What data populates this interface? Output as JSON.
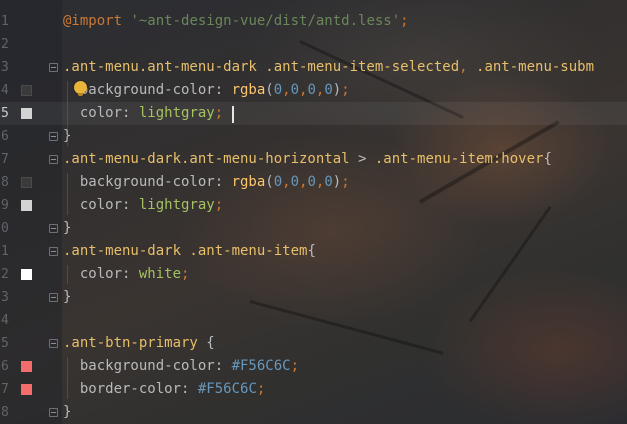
{
  "colors": {
    "background": "#2b2d33",
    "line_number": "#5f646b",
    "keyword": "#cc7832",
    "string": "#6a8759",
    "selector": "#e8bf6a",
    "property": "#bababa",
    "function": "#ffc66d",
    "number": "#6897bb",
    "value": "#a5c261",
    "swatch_transparent": "#3a3a3a",
    "swatch_lightgray": "#d3d3d3",
    "swatch_white": "#ffffff",
    "swatch_red": "#f56c6c"
  },
  "editor": {
    "current_line": 5,
    "lines": [
      {
        "n": "1",
        "tokens": [
          [
            "kw",
            "@import "
          ],
          [
            "str",
            "'~ant-design-vue/dist/antd.less'"
          ],
          [
            "punc",
            ";"
          ]
        ]
      },
      {
        "n": "2",
        "tokens": []
      },
      {
        "n": "3",
        "fold": true,
        "tokens": [
          [
            "sel",
            ".ant-menu.ant-menu-dark .ant-menu-item-selected"
          ],
          [
            "punc",
            ", "
          ],
          [
            "sel",
            ".ant-menu-subm"
          ]
        ]
      },
      {
        "n": "4",
        "swatch": "transparent",
        "tokens": [
          [
            "prop",
            "  background-color"
          ],
          [
            "plain",
            ": "
          ],
          [
            "fn",
            "rgba"
          ],
          [
            "plain",
            "("
          ],
          [
            "num",
            "0"
          ],
          [
            "punc",
            ","
          ],
          [
            "num",
            "0"
          ],
          [
            "punc",
            ","
          ],
          [
            "num",
            "0"
          ],
          [
            "punc",
            ","
          ],
          [
            "num",
            "0"
          ],
          [
            "plain",
            ")"
          ],
          [
            "punc",
            ";"
          ]
        ]
      },
      {
        "n": "5",
        "swatch": "lightgray",
        "tokens": [
          [
            "prop",
            "  color"
          ],
          [
            "plain",
            ": "
          ],
          [
            "val",
            "lightgray"
          ],
          [
            "punc",
            ";"
          ]
        ]
      },
      {
        "n": "6",
        "fold": true,
        "tokens": [
          [
            "plain",
            "}"
          ]
        ]
      },
      {
        "n": "7",
        "fold": true,
        "tokens": [
          [
            "sel",
            ".ant-menu-dark.ant-menu-horizontal "
          ],
          [
            "plain",
            "> "
          ],
          [
            "sel",
            ".ant-menu-item:hover"
          ],
          [
            "plain",
            "{"
          ]
        ]
      },
      {
        "n": "8",
        "swatch": "transparent",
        "tokens": [
          [
            "prop",
            "  background-color"
          ],
          [
            "plain",
            ": "
          ],
          [
            "fn",
            "rgba"
          ],
          [
            "plain",
            "("
          ],
          [
            "num",
            "0"
          ],
          [
            "punc",
            ","
          ],
          [
            "num",
            "0"
          ],
          [
            "punc",
            ","
          ],
          [
            "num",
            "0"
          ],
          [
            "punc",
            ","
          ],
          [
            "num",
            "0"
          ],
          [
            "plain",
            ")"
          ],
          [
            "punc",
            ";"
          ]
        ]
      },
      {
        "n": "9",
        "swatch": "lightgray",
        "tokens": [
          [
            "prop",
            "  color"
          ],
          [
            "plain",
            ": "
          ],
          [
            "val",
            "lightgray"
          ],
          [
            "punc",
            ";"
          ]
        ]
      },
      {
        "n": "0",
        "fold": true,
        "tokens": [
          [
            "plain",
            "}"
          ]
        ]
      },
      {
        "n": "1",
        "fold": true,
        "tokens": [
          [
            "sel",
            ".ant-menu-dark .ant-menu-item"
          ],
          [
            "plain",
            "{"
          ]
        ]
      },
      {
        "n": "2",
        "swatch": "white",
        "tokens": [
          [
            "prop",
            "  color"
          ],
          [
            "plain",
            ": "
          ],
          [
            "val",
            "white"
          ],
          [
            "punc",
            ";"
          ]
        ]
      },
      {
        "n": "3",
        "fold": true,
        "tokens": [
          [
            "plain",
            "}"
          ]
        ]
      },
      {
        "n": "4",
        "tokens": []
      },
      {
        "n": "5",
        "fold": true,
        "tokens": [
          [
            "sel",
            ".ant-btn-primary "
          ],
          [
            "plain",
            "{"
          ]
        ]
      },
      {
        "n": "6",
        "swatch": "red",
        "tokens": [
          [
            "prop",
            "  background-color"
          ],
          [
            "plain",
            ": "
          ],
          [
            "hex",
            "#F56C6C"
          ],
          [
            "punc",
            ";"
          ]
        ]
      },
      {
        "n": "7",
        "swatch": "red",
        "tokens": [
          [
            "prop",
            "  border-color"
          ],
          [
            "plain",
            ": "
          ],
          [
            "hex",
            "#F56C6C"
          ],
          [
            "punc",
            ";"
          ]
        ]
      },
      {
        "n": "8",
        "fold": true,
        "tokens": [
          [
            "plain",
            "}"
          ]
        ]
      }
    ]
  }
}
